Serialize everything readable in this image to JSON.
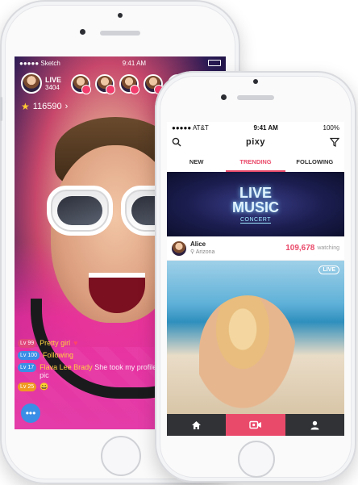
{
  "phone1": {
    "status": {
      "carrier": "●●●●● Sketch",
      "time": "9:41 AM"
    },
    "host": {
      "label": "LIVE",
      "count": "3404"
    },
    "coins": "116590",
    "chat": [
      {
        "level": "Lv 99",
        "level_color": "#e0457b",
        "user": "Pretty girl",
        "msg": "",
        "extra": ""
      },
      {
        "level": "Lv 100",
        "level_color": "#3a8ee6",
        "user": "Following",
        "msg": "",
        "extra": ""
      },
      {
        "level": "Lv 17",
        "level_color": "#3a8ee6",
        "user": "Flava Lee Brady",
        "msg": "She took my profile pic took my profile pic",
        "extra": ""
      },
      {
        "level": "Lv 25",
        "level_color": "#f09a22",
        "user": "",
        "msg": "",
        "extra": "😀"
      }
    ],
    "icons": {
      "chat": "chat-bubble-icon",
      "star": "star-icon"
    }
  },
  "phone2": {
    "status": {
      "carrier": "●●●●● AT&T",
      "time": "9:41 AM",
      "battery": "100%"
    },
    "brand": "pixy",
    "tabs": [
      {
        "label": "NEW",
        "active": false
      },
      {
        "label": "TRENDING",
        "active": true
      },
      {
        "label": "FOLLOWING",
        "active": false
      }
    ],
    "banner": {
      "line1": "LIVE",
      "line2": "MUSIC",
      "line3": "CONCERT"
    },
    "streamer": {
      "name": "Alice",
      "location": "Arizona",
      "viewers": "109,678",
      "viewers_label": "watching"
    },
    "live_badge": "LIVE",
    "accent": "#ea4a6a",
    "icons": {
      "search": "search-icon",
      "filter": "filter-icon",
      "home": "home-icon",
      "camera": "video-camera-icon",
      "profile": "profile-icon"
    }
  }
}
